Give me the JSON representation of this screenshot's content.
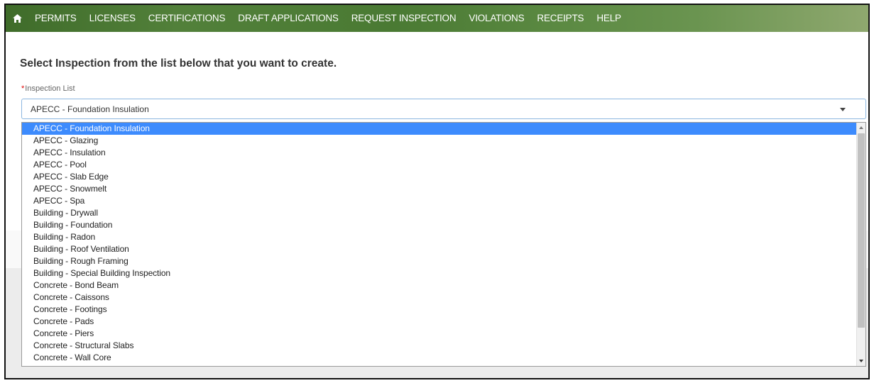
{
  "nav": {
    "home_icon": "home-icon",
    "items": [
      "PERMITS",
      "LICENSES",
      "CERTIFICATIONS",
      "DRAFT APPLICATIONS",
      "REQUEST INSPECTION",
      "VIOLATIONS",
      "RECEIPTS",
      "HELP"
    ]
  },
  "page": {
    "heading": "Select Inspection from the list below that you want to create."
  },
  "form": {
    "required_marker": "*",
    "field_label": "Inspection List",
    "selected_value": "APECC - Foundation Insulation",
    "options": [
      "APECC - Foundation Insulation",
      "APECC - Glazing",
      "APECC - Insulation",
      "APECC - Pool",
      "APECC - Slab Edge",
      "APECC - Snowmelt",
      "APECC - Spa",
      "Building - Drywall",
      "Building - Foundation",
      "Building - Radon",
      "Building - Roof Ventilation",
      "Building - Rough Framing",
      "Building - Special Building Inspection",
      "Concrete - Bond Beam",
      "Concrete - Caissons",
      "Concrete - Footings",
      "Concrete - Pads",
      "Concrete - Piers",
      "Concrete - Structural Slabs",
      "Concrete - Wall Core"
    ]
  },
  "colors": {
    "nav_green": "#4a7a33",
    "selected_option": "#3d8bfd",
    "required": "#dd0000"
  }
}
